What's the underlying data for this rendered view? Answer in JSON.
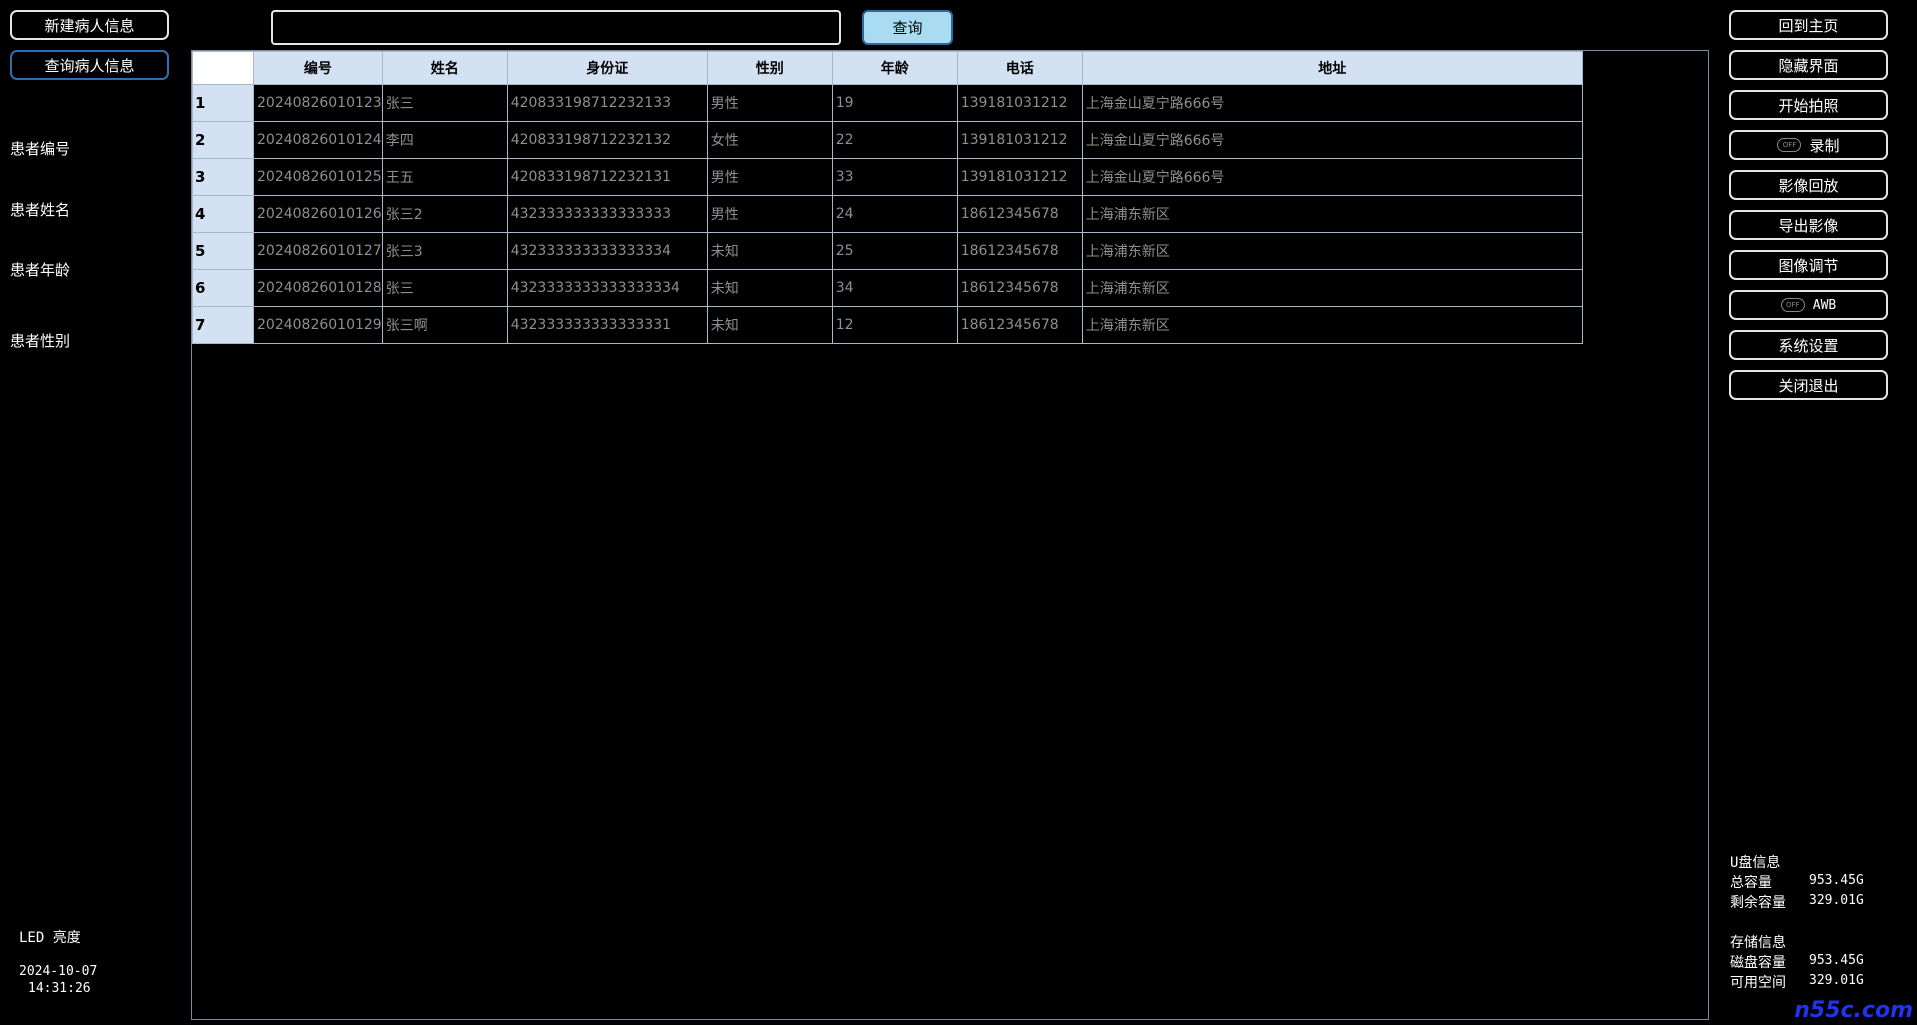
{
  "left_panel": {
    "new_patient_label": "新建病人信息",
    "query_patient_label": "查询病人信息",
    "fields": [
      "患者编号",
      "患者姓名",
      "患者年龄",
      "患者性别"
    ],
    "led_label": "LED 亮度",
    "date": "2024-10-07",
    "time": "14:31:26"
  },
  "search": {
    "value": "",
    "placeholder": "",
    "button_label": "查询"
  },
  "table": {
    "columns": [
      "编号",
      "姓名",
      "身份证",
      "性别",
      "年龄",
      "电话",
      "地址"
    ],
    "rows": [
      {
        "idx": "1",
        "id": "20240826010123",
        "name": "张三",
        "idcard": "420833198712232133",
        "gender": "男性",
        "age": "19",
        "phone": "139181031212",
        "address": "上海金山夏宁路666号"
      },
      {
        "idx": "2",
        "id": "20240826010124",
        "name": "李四",
        "idcard": "420833198712232132",
        "gender": "女性",
        "age": "22",
        "phone": "139181031212",
        "address": "上海金山夏宁路666号"
      },
      {
        "idx": "3",
        "id": "20240826010125",
        "name": "王五",
        "idcard": "420833198712232131",
        "gender": "男性",
        "age": "33",
        "phone": "139181031212",
        "address": "上海金山夏宁路666号"
      },
      {
        "idx": "4",
        "id": "20240826010126",
        "name": "张三2",
        "idcard": "432333333333333333",
        "gender": "男性",
        "age": "24",
        "phone": "18612345678",
        "address": "上海浦东新区"
      },
      {
        "idx": "5",
        "id": "20240826010127",
        "name": "张三3",
        "idcard": "432333333333333334",
        "gender": "未知",
        "age": "25",
        "phone": "18612345678",
        "address": "上海浦东新区"
      },
      {
        "idx": "6",
        "id": "20240826010128",
        "name": "张三",
        "idcard": "4323333333333333334",
        "gender": "未知",
        "age": "34",
        "phone": "18612345678",
        "address": "上海浦东新区"
      },
      {
        "idx": "7",
        "id": "20240826010129",
        "name": "张三啊",
        "idcard": "432333333333333331",
        "gender": "未知",
        "age": "12",
        "phone": "18612345678",
        "address": "上海浦东新区"
      }
    ]
  },
  "right_panel": {
    "home": "回到主页",
    "hide_ui": "隐藏界面",
    "photo": "开始拍照",
    "record": "录制",
    "playback": "影像回放",
    "export": "导出影像",
    "adjust": "图像调节",
    "awb": "AWB",
    "toggle_off": "OFF",
    "settings": "系统设置",
    "exit": "关闭退出",
    "usb_title": "U盘信息",
    "usb_total_label": "总容量",
    "usb_total": "953.45G",
    "usb_free_label": "剩余容量",
    "usb_free": "329.01G",
    "storage_title": "存储信息",
    "disk_total_label": "磁盘容量",
    "disk_total": "953.45G",
    "disk_free_label": "可用空间",
    "disk_free": "329.01G"
  },
  "watermark": "n55c.com"
}
